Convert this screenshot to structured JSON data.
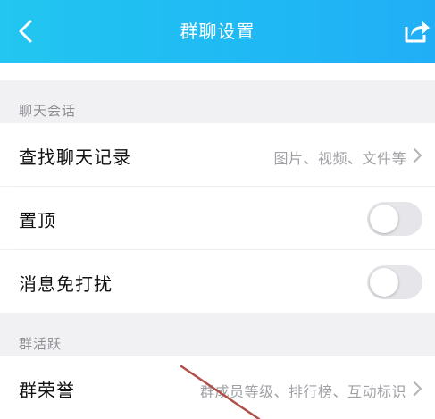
{
  "header": {
    "title": "群聊设置"
  },
  "sections": {
    "chat": "聊天会话",
    "activity": "群活跃"
  },
  "rows": {
    "search": {
      "label": "查找聊天记录",
      "hint": "图片、视频、文件等"
    },
    "pin": {
      "label": "置顶",
      "on": false
    },
    "mute": {
      "label": "消息免打扰",
      "on": false
    },
    "honor": {
      "label": "群荣誉",
      "hint": "群成员等级、排行榜、互动标识"
    }
  },
  "colors": {
    "header": "#1fb8f4",
    "toggle_off": "#e6e6ea",
    "annotation": "#b0504a"
  },
  "icons": {
    "back": "chevron-left-icon",
    "share": "share-icon",
    "chevron": "chevron-right-icon"
  }
}
